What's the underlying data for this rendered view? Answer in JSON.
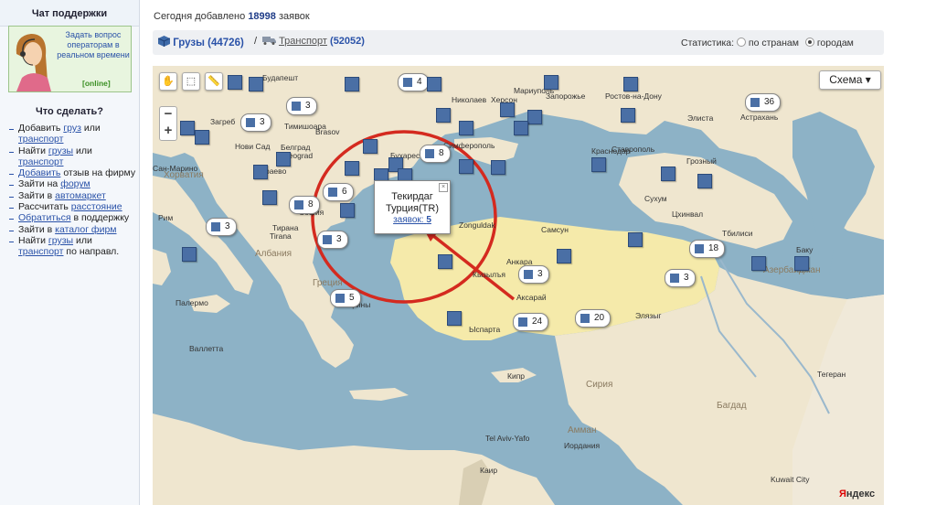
{
  "sidebar": {
    "chat_title": "Чат поддержки",
    "chat_text": "Задать вопрос операторам в реальном времени",
    "chat_status": "[online]",
    "todo_title": "Что сделать?",
    "todo_items": [
      {
        "pre": "Добавить ",
        "link": "груз",
        "mid": " или ",
        "link2": "транспорт",
        "post": ""
      },
      {
        "pre": "Найти ",
        "link": "грузы",
        "mid": " или ",
        "link2": "транспорт",
        "post": ""
      },
      {
        "pre": "",
        "link": "Добавить",
        "mid": " отзыв на фирму",
        "link2": "",
        "post": ""
      },
      {
        "pre": "Зайти на ",
        "link": "форум",
        "mid": "",
        "link2": "",
        "post": ""
      },
      {
        "pre": "Зайти в ",
        "link": "автомаркет",
        "mid": "",
        "link2": "",
        "post": ""
      },
      {
        "pre": "Рассчитать ",
        "link": "расстояние",
        "mid": "",
        "link2": "",
        "post": ""
      },
      {
        "pre": "",
        "link": "Обратиться",
        "mid": " в поддержку",
        "link2": "",
        "post": ""
      },
      {
        "pre": "Зайти в ",
        "link": "каталог фирм",
        "mid": "",
        "link2": "",
        "post": ""
      },
      {
        "pre": "Найти ",
        "link": "грузы",
        "mid": " или ",
        "link2": "транспорт",
        "post": " по направл."
      }
    ]
  },
  "header": {
    "added_prefix": "Сегодня добавлено",
    "added_count": "18998",
    "added_suffix": "заявок",
    "cargo_label": "Грузы",
    "cargo_count": "(44726)",
    "slash": "/",
    "transport_label": "Транспорт",
    "transport_count": "(52052)",
    "stats_label": "Статистика:",
    "stats_opt1": "по странам",
    "stats_opt2": "городам"
  },
  "map": {
    "schema_label": "Схема",
    "popup": {
      "city": "Текирдаг",
      "country": "Турция(TR)",
      "link_label": "заявок:",
      "count": "5"
    },
    "yandex": "Яндекс",
    "labels": [
      "Будапешт",
      "Николаев",
      "Херсон",
      "Мариуполь",
      "Запорожье",
      "Ростов-на-Дону",
      "Элиста",
      "Астрахань",
      "Загреб",
      "Нови Сад",
      "Тимишоара",
      "Brasov",
      "Белград",
      "Beograd",
      "Бухарест",
      "Симферополь",
      "Краснодар",
      "Ставрополь",
      "Грозный",
      "Хорватия",
      "Сан-Марино",
      "Сараево",
      "Сухум",
      "Цхинвал",
      "София",
      "Рим",
      "Тирана",
      "Tirana",
      "Самсун",
      "Анкара",
      "Тбилиси",
      "Баку",
      "Албания",
      "Zonguldak",
      "Азербайджан",
      "Греция",
      "Кызылъя",
      "Аксарай",
      "Палермо",
      "Афины",
      "Элязыг",
      "Ыспарта",
      "Валлетта",
      "Кипр",
      "Сирия",
      "Багдад",
      "Тегеран",
      "Tel Aviv-Yafo",
      "Амман",
      "Иордания",
      "Каир",
      "Kuwait City"
    ],
    "markers": [
      "4",
      "3",
      "36",
      "3",
      "8",
      "6",
      "8",
      "3",
      "3",
      "3",
      "18",
      "5",
      "3",
      "24",
      "20"
    ],
    "colors": {
      "sea": "#8db2c6",
      "land": "#efe6cf",
      "turkey": "#f5eaaa",
      "marker": "#4a6fa5",
      "circle": "#d42a1f"
    }
  }
}
